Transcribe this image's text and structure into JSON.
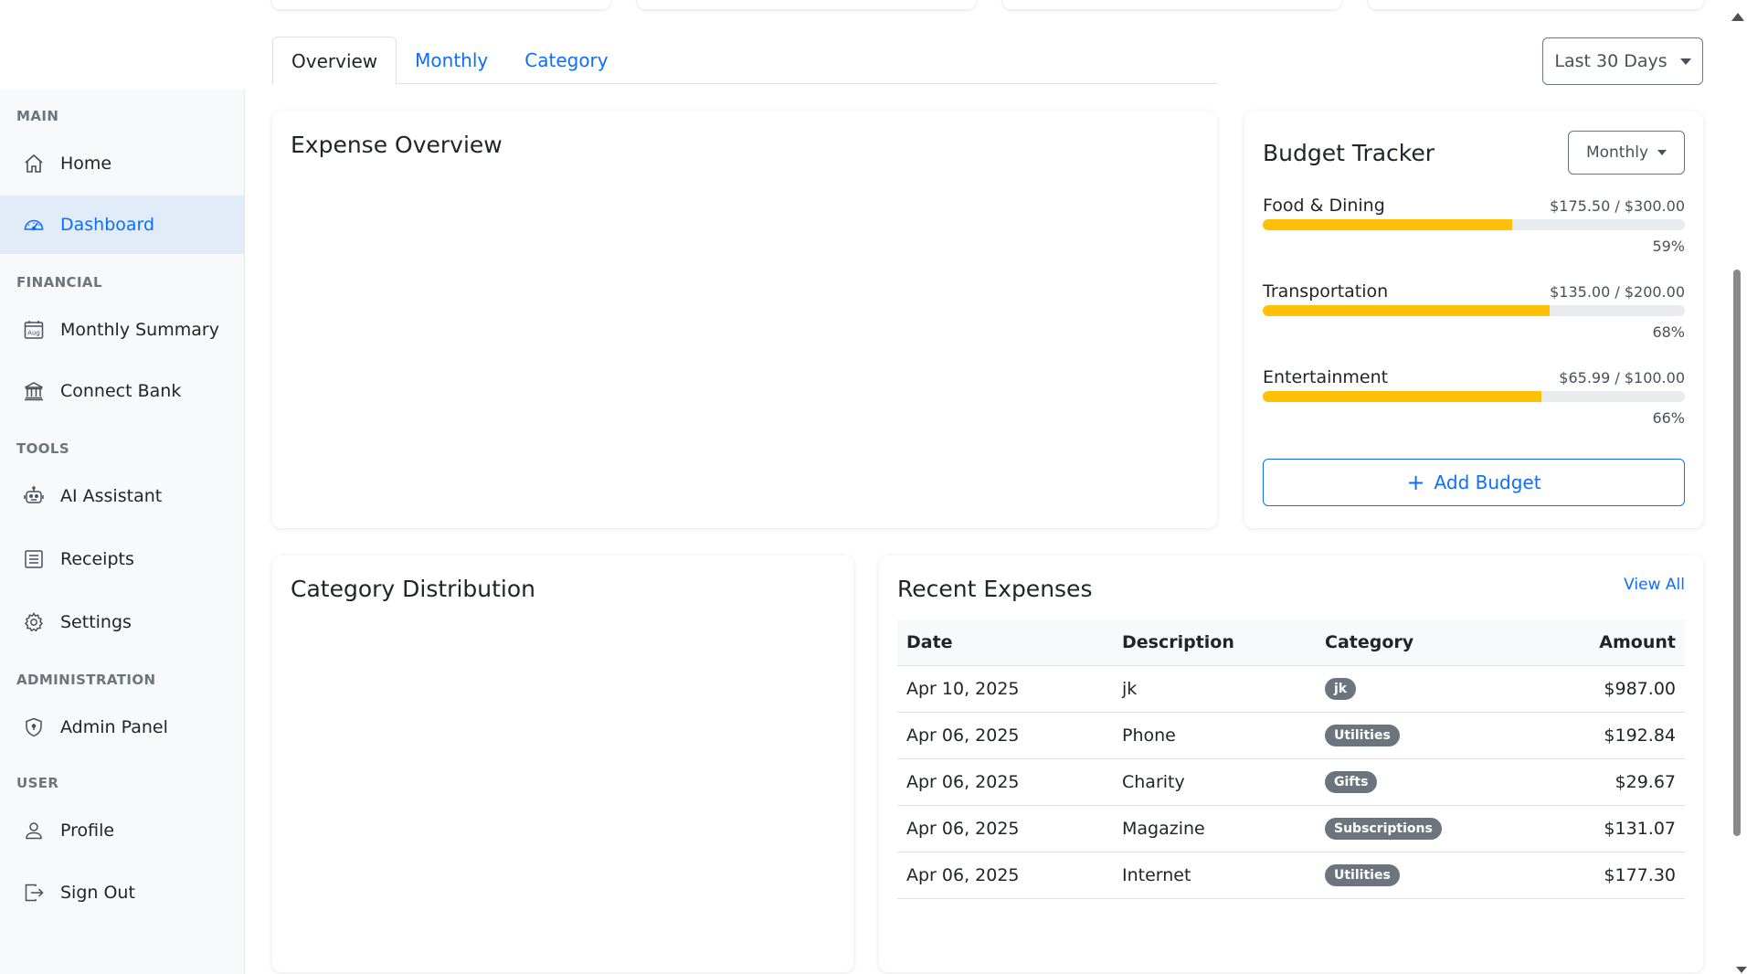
{
  "sidebar": {
    "sections": [
      {
        "title": "MAIN",
        "items": [
          {
            "label": "Home",
            "icon": "home-icon"
          },
          {
            "label": "Dashboard",
            "icon": "speedometer-icon",
            "active": true
          }
        ]
      },
      {
        "title": "FINANCIAL",
        "items": [
          {
            "label": "Monthly Summary",
            "icon": "calendar-month-icon",
            "calendar_text": "Aug"
          },
          {
            "label": "Connect Bank",
            "icon": "bank-icon"
          }
        ]
      },
      {
        "title": "TOOLS",
        "items": [
          {
            "label": "AI Assistant",
            "icon": "robot-icon"
          },
          {
            "label": "Receipts",
            "icon": "receipt-icon"
          },
          {
            "label": "Settings",
            "icon": "gear-icon"
          }
        ]
      },
      {
        "title": "ADMINISTRATION",
        "items": [
          {
            "label": "Admin Panel",
            "icon": "shield-icon"
          }
        ]
      },
      {
        "title": "USER",
        "items": [
          {
            "label": "Profile",
            "icon": "person-icon"
          },
          {
            "label": "Sign Out",
            "icon": "sign-out-icon"
          }
        ]
      }
    ]
  },
  "tabs": [
    {
      "label": "Overview",
      "active": true
    },
    {
      "label": "Monthly"
    },
    {
      "label": "Category"
    }
  ],
  "date_range": {
    "label": "Last 30 Days"
  },
  "expense_overview": {
    "title": "Expense Overview"
  },
  "budget_tracker": {
    "title": "Budget Tracker",
    "period": "Monthly",
    "items": [
      {
        "label": "Food & Dining",
        "amount": "$175.50 / $300.00",
        "percent_label": "59%",
        "percent": 59
      },
      {
        "label": "Transportation",
        "amount": "$135.00 / $200.00",
        "percent_label": "68%",
        "percent": 68
      },
      {
        "label": "Entertainment",
        "amount": "$65.99 / $100.00",
        "percent_label": "66%",
        "percent": 66
      }
    ],
    "add_label": "Add Budget",
    "bar_color": "#ffc107"
  },
  "category_distribution": {
    "title": "Category Distribution"
  },
  "recent_expenses": {
    "title": "Recent Expenses",
    "view_all": "View All",
    "columns": [
      "Date",
      "Description",
      "Category",
      "Amount"
    ],
    "rows": [
      {
        "date": "Apr 10, 2025",
        "description": "jk",
        "category": "jk",
        "amount": "$987.00"
      },
      {
        "date": "Apr 06, 2025",
        "description": "Phone",
        "category": "Utilities",
        "amount": "$192.84"
      },
      {
        "date": "Apr 06, 2025",
        "description": "Charity",
        "category": "Gifts",
        "amount": "$29.67"
      },
      {
        "date": "Apr 06, 2025",
        "description": "Magazine",
        "category": "Subscriptions",
        "amount": "$131.07"
      },
      {
        "date": "Apr 06, 2025",
        "description": "Internet",
        "category": "Utilities",
        "amount": "$177.30"
      }
    ]
  },
  "colors": {
    "accent": "#0d6efd",
    "badge": "#6c757d",
    "sidebar_active_bg": "#e2ecf8"
  }
}
